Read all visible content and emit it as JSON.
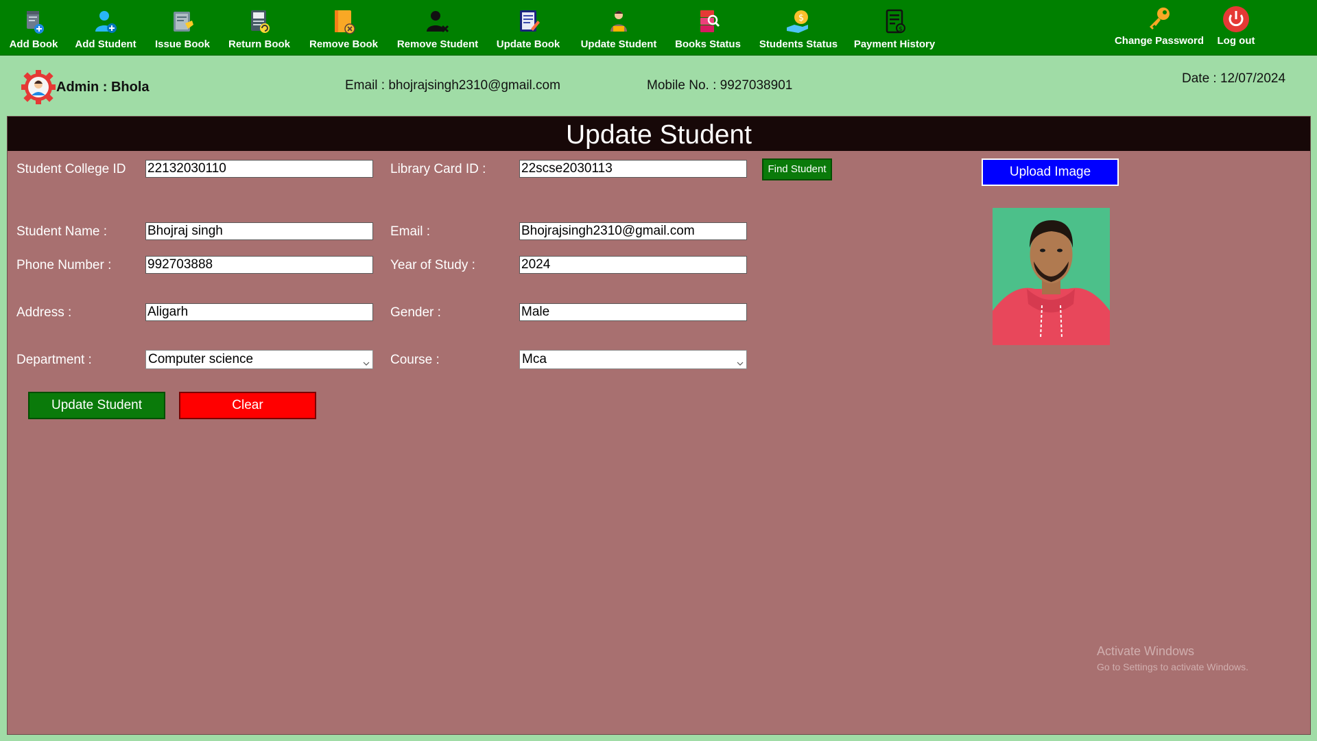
{
  "toolbar": {
    "items": [
      {
        "label": "Add Book",
        "icon": "add-book-icon"
      },
      {
        "label": "Add Student",
        "icon": "add-student-icon"
      },
      {
        "label": "Issue Book",
        "icon": "issue-book-icon"
      },
      {
        "label": "Return Book",
        "icon": "return-book-icon"
      },
      {
        "label": "Remove Book",
        "icon": "remove-book-icon"
      },
      {
        "label": "Remove Student",
        "icon": "remove-student-icon"
      },
      {
        "label": "Update Book",
        "icon": "update-book-icon"
      },
      {
        "label": "Update Student",
        "icon": "update-student-icon"
      },
      {
        "label": "Books Status",
        "icon": "books-status-icon"
      },
      {
        "label": "Students Status",
        "icon": "students-status-icon"
      },
      {
        "label": "Payment History",
        "icon": "payment-history-icon"
      }
    ],
    "change_password": {
      "label": "Change Password",
      "icon": "key-icon"
    },
    "logout": {
      "label": "Log out",
      "icon": "power-icon"
    }
  },
  "header": {
    "admin": "Admin : Bhola",
    "email": "Email : bhojrajsingh2310@gmail.com",
    "mobile": "Mobile No. : 9927038901",
    "date": "Date : 12/07/2024"
  },
  "panel": {
    "title": "Update Student",
    "labels": {
      "college_id": "Student College ID",
      "library_card_id": "Library Card ID :",
      "name": "Student Name :",
      "email": "Email :",
      "phone": "Phone Number :",
      "year": "Year of Study :",
      "address": "Address :",
      "gender": "Gender :",
      "department": "Department :",
      "course": "Course :"
    },
    "values": {
      "college_id": "22132030110",
      "library_card_id": "22scse2030113",
      "name": "Bhojraj singh",
      "email": "Bhojrajsingh2310@gmail.com",
      "phone": "992703888",
      "year": "2024",
      "address": "Aligarh",
      "gender": "Male",
      "department": "Computer science",
      "course": "Mca"
    },
    "buttons": {
      "find": "Find Student",
      "upload": "Upload Image",
      "update": "Update Student",
      "clear": "Clear"
    }
  },
  "watermark": {
    "title": "Activate Windows",
    "subtitle": "Go to Settings to activate Windows."
  },
  "colors": {
    "toolbar": "#008000",
    "background": "#a0dca6",
    "panel": "#a87070",
    "title_bar": "#170808",
    "upload_button": "#0000ff",
    "update_button": "#0a7a0a",
    "clear_button": "#ff0000"
  }
}
